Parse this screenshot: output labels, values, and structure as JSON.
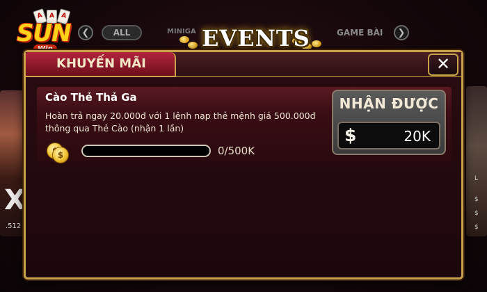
{
  "logo": {
    "brand": "SUN",
    "sub": "Win",
    "cards": [
      "A",
      "A",
      "A"
    ]
  },
  "topbar": {
    "all_label": "ALL",
    "minigame_label": "MINIGA",
    "gamebai_label": "GAME BÀI",
    "events_title": "EVENTS",
    "left_arrow": "❮",
    "right_arrow": "❯"
  },
  "side": {
    "left_big": "X",
    "left_num": ".512",
    "right_nums": [
      "L",
      "$",
      "$",
      "$"
    ]
  },
  "dialog": {
    "tab_label": "KHUYẾN MÃI",
    "close_glyph": "✕",
    "event": {
      "title": "Cào Thẻ Thả Ga",
      "desc_line1": "Hoàn trả ngay 20.000đ với 1 lệnh nạp thẻ mệnh giá 500.000đ",
      "desc_line2": "thông qua Thẻ Cào (nhận 1 lần)",
      "coin_glyph": "$",
      "progress_text": "0/500K",
      "progress_fraction": 0,
      "reward_label": "NHẬN ĐƯỢC",
      "dollar_glyph": "$",
      "reward_value": "20K"
    }
  }
}
